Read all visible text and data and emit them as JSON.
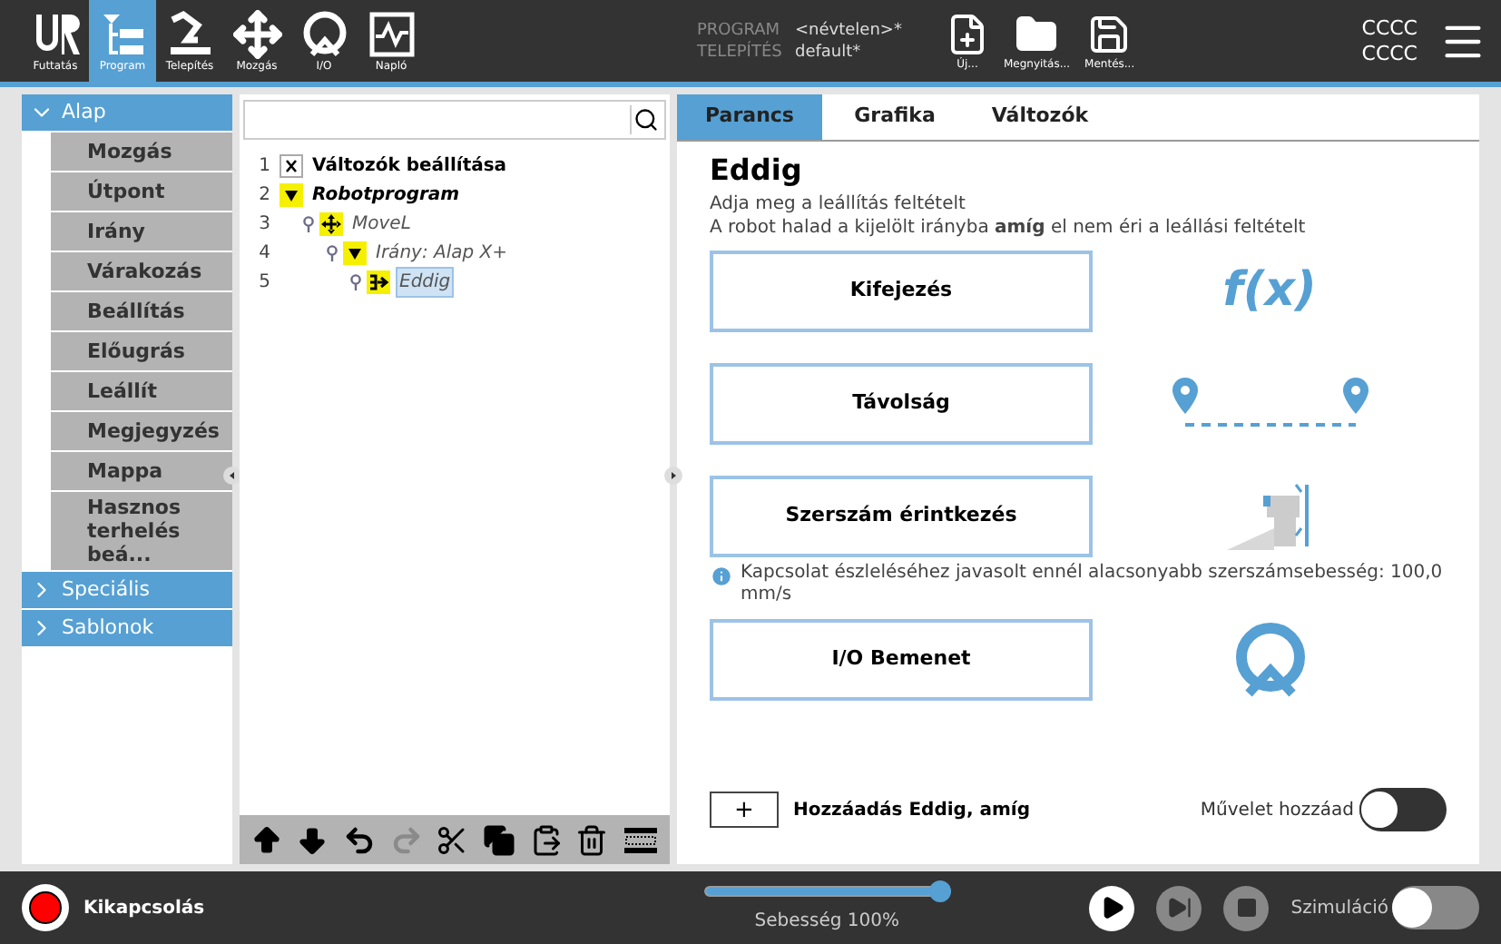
{
  "nav_tabs": [
    {
      "label": "Futtatás",
      "kind": "logo",
      "selected": false
    },
    {
      "label": "Program",
      "kind": "program",
      "selected": true
    },
    {
      "label": "Telepítés",
      "kind": "robot",
      "selected": false
    },
    {
      "label": "Mozgás",
      "kind": "move",
      "selected": false
    },
    {
      "label": "I/O",
      "kind": "io",
      "selected": false
    },
    {
      "label": "Napló",
      "kind": "log",
      "selected": false
    }
  ],
  "file_info": {
    "program_label": "PROGRAM",
    "program_value": "<névtelen>*",
    "installation_label": "TELEPÍTÉS",
    "installation_value": "default*"
  },
  "file_buttons": [
    {
      "label": "Új...",
      "kind": "new"
    },
    {
      "label": "Megnyitás...",
      "kind": "open"
    },
    {
      "label": "Mentés...",
      "kind": "save"
    }
  ],
  "corner_text": [
    "CCCC",
    "CCCC"
  ],
  "sidebar": [
    {
      "label": "Alap",
      "expanded": true,
      "items": [
        "Mozgás",
        "Útpont",
        "Irány",
        "Várakozás",
        "Beállítás",
        "Előugrás",
        "Leállít",
        "Megjegyzés",
        "Mappa",
        "Hasznos terhelés beá..."
      ]
    },
    {
      "label": "Speciális",
      "expanded": false
    },
    {
      "label": "Sablonok",
      "expanded": false
    }
  ],
  "tree": {
    "nodes": [
      {
        "number": "1",
        "label": "Változók beállítása",
        "kind": "variables",
        "selected": false
      },
      {
        "number": "2",
        "label": "Robotprogram",
        "kind": "root",
        "selected": false,
        "children": [
          {
            "number": "3",
            "label": "MoveL",
            "kind": "move",
            "selected": false,
            "children": [
              {
                "number": "4",
                "label": "Irány: Alap X+",
                "kind": "direction",
                "selected": false,
                "children": [
                  {
                    "number": "5",
                    "label": "Eddig",
                    "kind": "until",
                    "selected": true
                  }
                ]
              }
            ]
          }
        ]
      }
    ],
    "toolbar": [
      {
        "kind": "up",
        "disabled": false
      },
      {
        "kind": "down",
        "disabled": false
      },
      {
        "kind": "undo",
        "disabled": false
      },
      {
        "kind": "redo",
        "disabled": true
      },
      {
        "kind": "cut",
        "disabled": false
      },
      {
        "kind": "copy",
        "disabled": false
      },
      {
        "kind": "paste",
        "disabled": false
      },
      {
        "kind": "delete",
        "disabled": false
      },
      {
        "kind": "suppress",
        "disabled": false
      }
    ]
  },
  "tabs": [
    {
      "label": "Parancs",
      "selected": true
    },
    {
      "label": "Grafika",
      "selected": false
    },
    {
      "label": "Változók",
      "selected": false
    }
  ],
  "command": {
    "title": "Eddig",
    "description": [
      "Adja meg a leállítás feltételt",
      "A robot halad a kijelölt irányba **amíg** el nem éri a leállási feltételt"
    ],
    "options": [
      {
        "label": "Kifejezés",
        "kind": "expression",
        "symbol": "f(x)"
      },
      {
        "label": "Távolság",
        "kind": "distance"
      },
      {
        "label": "Szerszám érintkezés",
        "kind": "contact",
        "note": "Kapcsolat észleléséhez javasolt ennél alacsonyabb szerszámsebesség: 100,0 mm/s"
      },
      {
        "label": "I/O Bemenet",
        "kind": "io"
      }
    ],
    "add_button": "+",
    "add_label": "Hozzáadás Eddig, amíg",
    "toggle_label": "Művelet hozzáad",
    "toggle_on": false
  },
  "footer": {
    "power_label": "Kikapcsolás",
    "speed": {
      "level": 1.0
    },
    "speed_label": "Sebesség 100%",
    "simulation_label": "Szimuláció",
    "simulation_on": false
  }
}
